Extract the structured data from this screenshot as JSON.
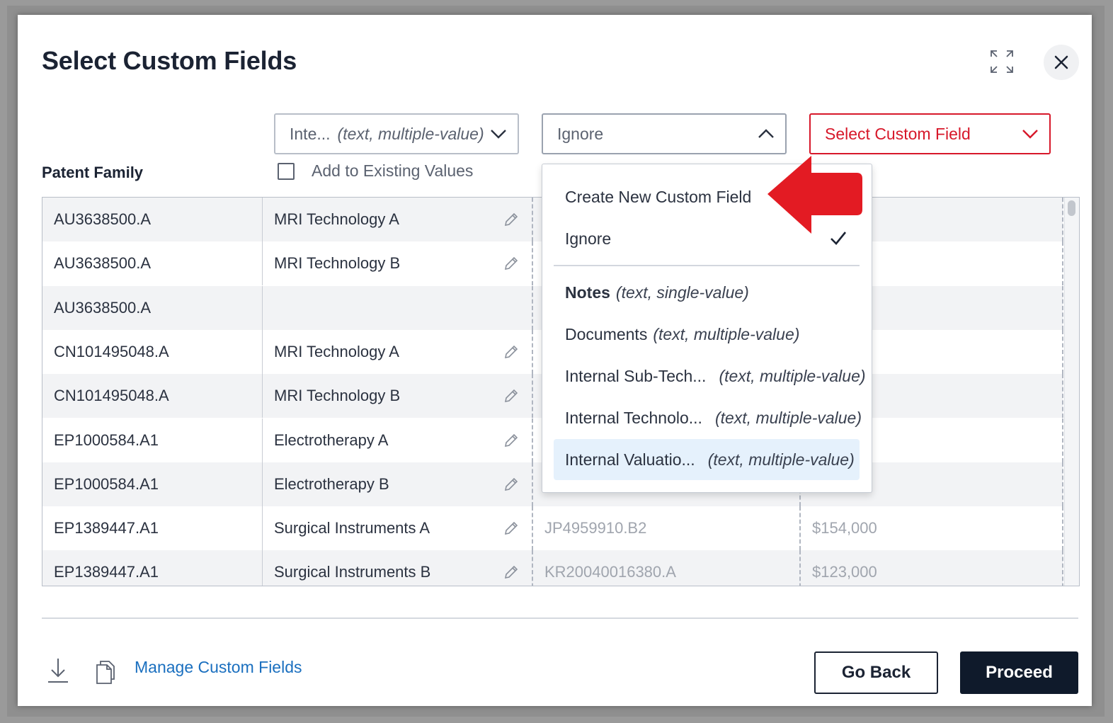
{
  "dialog": {
    "title": "Select Custom Fields",
    "column_label": "Patent Family"
  },
  "selects": [
    {
      "name": "Inte...",
      "type": "(text, multiple-value)"
    },
    {
      "name": "Ignore",
      "type": ""
    },
    {
      "name": "Select Custom Field",
      "type": ""
    }
  ],
  "checkbox": {
    "label": "Add to Existing Values",
    "checked": false
  },
  "table": {
    "rows": [
      {
        "family": "AU3638500.A",
        "tech": "MRI Technology A",
        "ref": "",
        "value": "",
        "edit": true
      },
      {
        "family": "AU3638500.A",
        "tech": "MRI Technology B",
        "ref": "",
        "value": "",
        "edit": true
      },
      {
        "family": "AU3638500.A",
        "tech": "",
        "ref": "",
        "value": "",
        "edit": false
      },
      {
        "family": "CN101495048.A",
        "tech": "MRI Technology A",
        "ref": "",
        "value": "",
        "edit": true
      },
      {
        "family": "CN101495048.A",
        "tech": "MRI Technology B",
        "ref": "",
        "value": "",
        "edit": true
      },
      {
        "family": "EP1000584.A1",
        "tech": "Electrotherapy A",
        "ref": "",
        "value": "",
        "edit": true
      },
      {
        "family": "EP1000584.A1",
        "tech": "Electrotherapy B",
        "ref": "",
        "value": "",
        "edit": true
      },
      {
        "family": "EP1389447.A1",
        "tech": "Surgical Instruments A",
        "ref": "JP4959910.B2",
        "value": "$154,000",
        "edit": true
      },
      {
        "family": "EP1389447.A1",
        "tech": "Surgical Instruments B",
        "ref": "KR20040016380.A",
        "value": "$123,000",
        "edit": true
      }
    ]
  },
  "dropdown": {
    "options": [
      {
        "name": "Create New Custom Field",
        "type": ""
      },
      {
        "name": "Ignore",
        "type": "",
        "selected": true
      },
      {
        "name": "Notes",
        "type": "(text, single-value)"
      },
      {
        "name": "Documents",
        "type": "(text, multiple-value)"
      },
      {
        "name": "Internal Sub-Tech...",
        "type": "(text, multiple-value)"
      },
      {
        "name": "Internal Technolo...",
        "type": "(text, multiple-value)"
      },
      {
        "name": "Internal Valuatio...",
        "type": "(text, multiple-value)",
        "highlighted": true
      }
    ]
  },
  "footer": {
    "manage_link": "Manage Custom Fields",
    "go_back": "Go Back",
    "proceed": "Proceed"
  },
  "colors": {
    "accent_red": "#d7182a",
    "navy": "#0f1a2b",
    "link": "#1a6fbf",
    "highlight": "#e5f1fc"
  }
}
